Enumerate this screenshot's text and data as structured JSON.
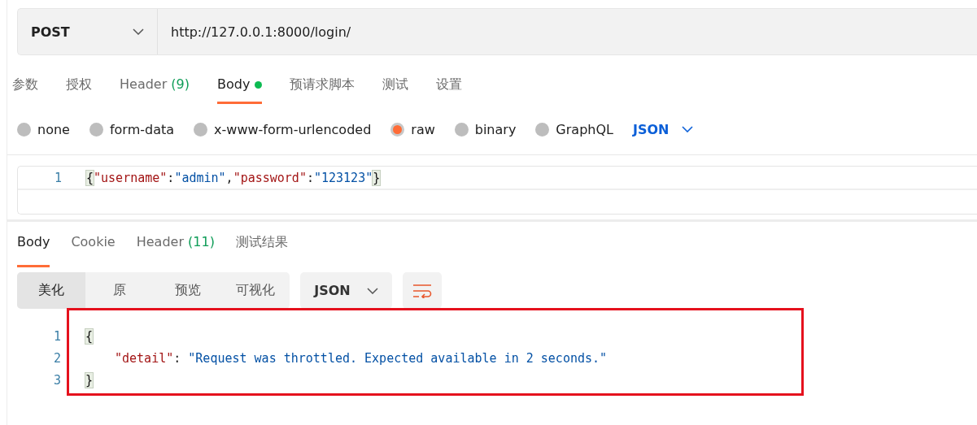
{
  "request": {
    "method": "POST",
    "url": "http://127.0.0.1:8000/login/"
  },
  "request_tabs": [
    {
      "label": "参数",
      "selected": false
    },
    {
      "label": "授权",
      "selected": false
    },
    {
      "label": "Header",
      "count": "(9)",
      "selected": false
    },
    {
      "label": "Body",
      "selected": true,
      "has_content": true
    },
    {
      "label": "预请求脚本",
      "selected": false
    },
    {
      "label": "测试",
      "selected": false
    },
    {
      "label": "设置",
      "selected": false
    }
  ],
  "body_types": [
    {
      "label": "none",
      "selected": false
    },
    {
      "label": "form-data",
      "selected": false
    },
    {
      "label": "x-www-form-urlencoded",
      "selected": false
    },
    {
      "label": "raw",
      "selected": true
    },
    {
      "label": "binary",
      "selected": false
    },
    {
      "label": "GraphQL",
      "selected": false
    }
  ],
  "raw_format": "JSON",
  "request_body": [
    {
      "number": "1",
      "tokens": [
        {
          "kind": "brace",
          "text": "{"
        },
        {
          "kind": "key",
          "text": "\"username\""
        },
        {
          "kind": "punct",
          "text": ":"
        },
        {
          "kind": "string",
          "text": "\"admin\""
        },
        {
          "kind": "punct",
          "text": ","
        },
        {
          "kind": "key",
          "text": "\"password\""
        },
        {
          "kind": "punct",
          "text": ":"
        },
        {
          "kind": "string",
          "text": "\"123123\""
        },
        {
          "kind": "brace",
          "text": "}"
        }
      ]
    }
  ],
  "response_tabs": [
    {
      "label": "Body",
      "selected": true
    },
    {
      "label": "Cookie",
      "selected": false
    },
    {
      "label": "Header",
      "count": "(11)",
      "selected": false
    },
    {
      "label": "测试结果",
      "selected": false
    }
  ],
  "view_modes": [
    {
      "label": "美化",
      "selected": true
    },
    {
      "label": "原",
      "selected": false
    },
    {
      "label": "预览",
      "selected": false
    },
    {
      "label": "可视化",
      "selected": false
    }
  ],
  "response_format": "JSON",
  "response_body": [
    {
      "number": "1",
      "tokens": [
        {
          "kind": "brace",
          "text": "{"
        }
      ]
    },
    {
      "number": "2",
      "indented": true,
      "tokens": [
        {
          "kind": "key",
          "text": "\"detail\""
        },
        {
          "kind": "punct",
          "text": ": "
        },
        {
          "kind": "string",
          "text": "\"Request was throttled. Expected available in 2 seconds.\""
        }
      ]
    },
    {
      "number": "3",
      "tokens": [
        {
          "kind": "brace",
          "text": "}"
        }
      ]
    }
  ]
}
